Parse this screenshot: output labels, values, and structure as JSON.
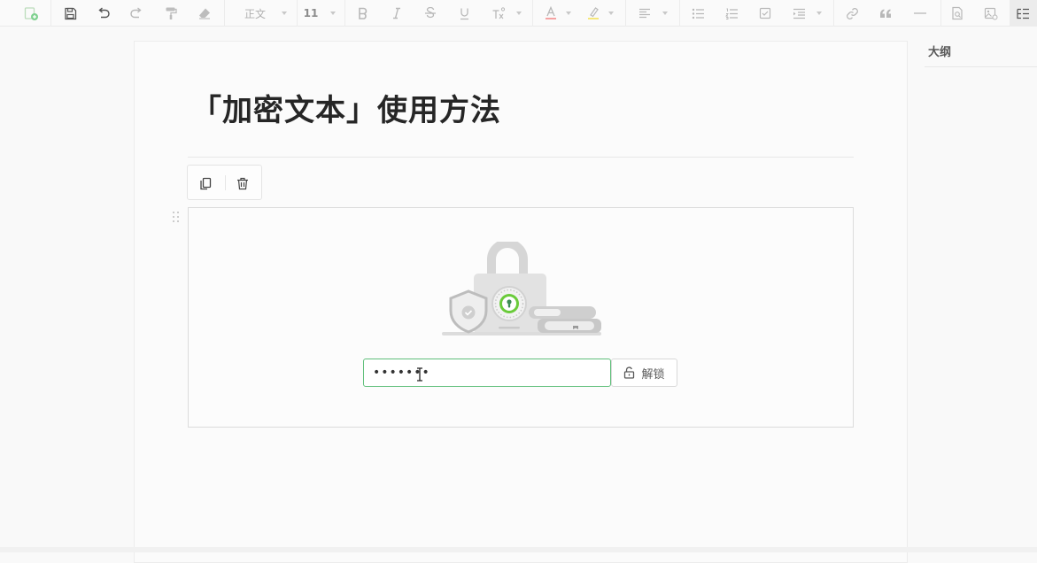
{
  "toolbar": {
    "paragraph_style": "正文",
    "font_size": "11",
    "tool_icons": [
      "new-doc-icon",
      "save-icon",
      "undo-icon",
      "redo-icon",
      "format-painter-icon",
      "clear-format-icon",
      "bold-icon",
      "italic-icon",
      "strikethrough-icon",
      "underline-icon",
      "superscript-icon",
      "font-color-icon",
      "highlight-icon",
      "align-icon",
      "bullet-list-icon",
      "numbered-list-icon",
      "checklist-icon",
      "indent-icon",
      "link-icon",
      "quote-icon",
      "divider-icon",
      "doc-search-icon",
      "image-icon",
      "outline-toggle-icon"
    ]
  },
  "document": {
    "title": "「加密文本」使用方法"
  },
  "encrypted_block": {
    "password_value": "•••••••",
    "unlock_label": "解锁"
  },
  "outline": {
    "title": "大纲"
  },
  "colors": {
    "accent_green": "#52c41a",
    "input_border": "#5fbf7a",
    "lock_gray": "#d9d9d9"
  }
}
